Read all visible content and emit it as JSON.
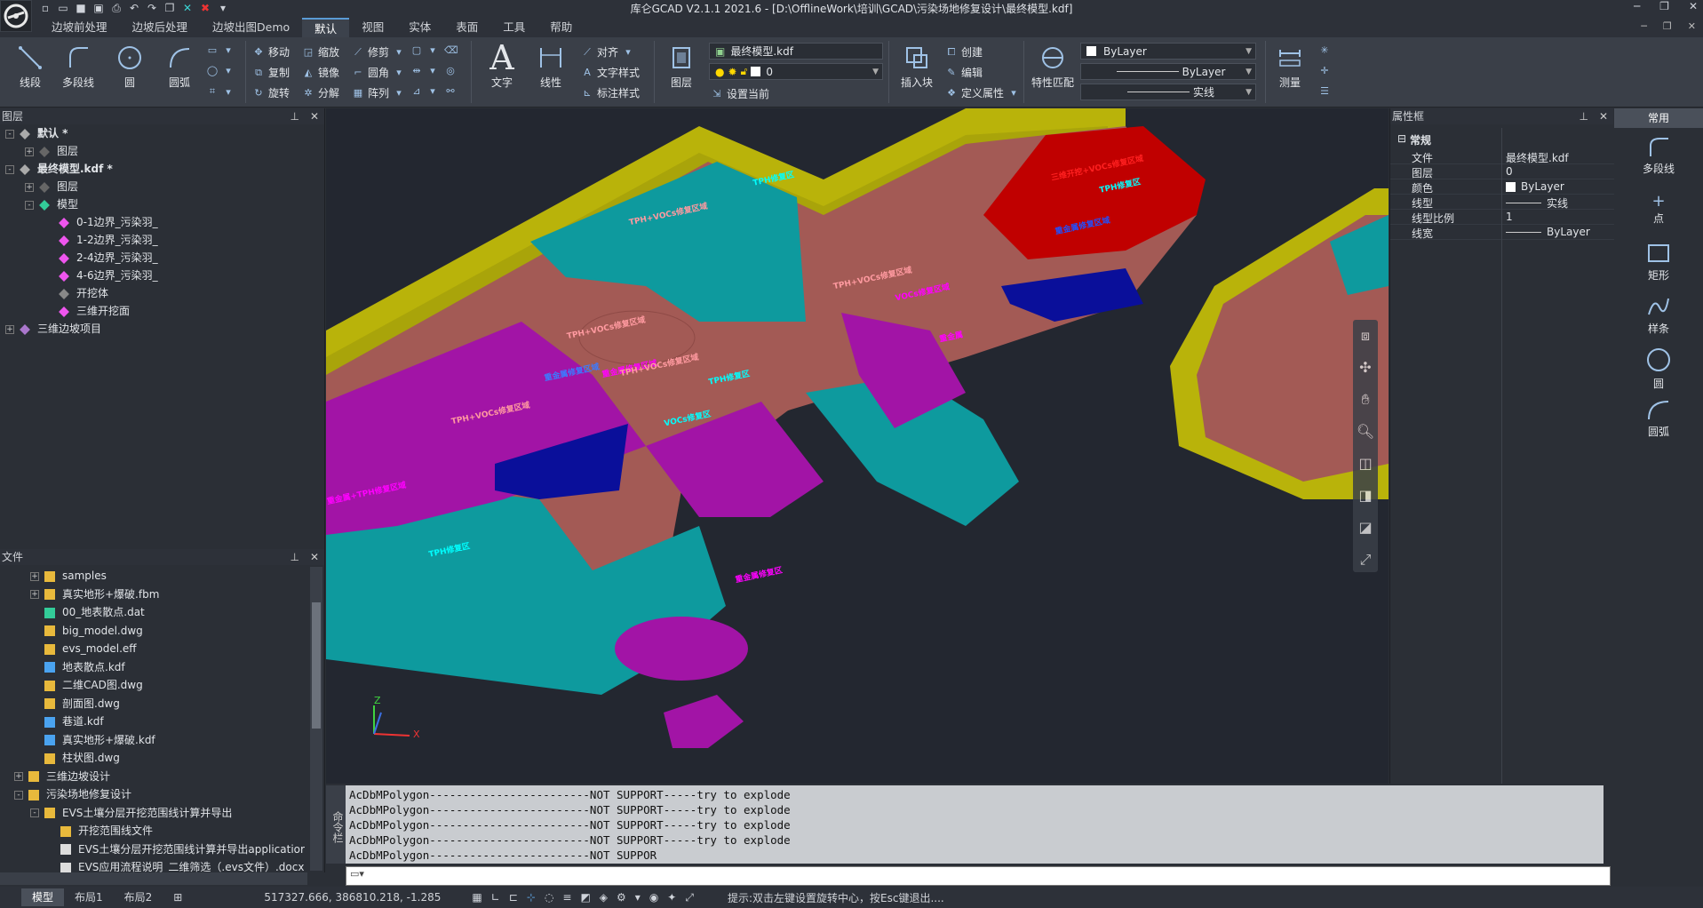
{
  "app": {
    "title": "库仑GCAD V2.1.1 2021.6 - [D:\\OfflineWork\\培训\\GCAD\\污染场地修复设计\\最终模型.kdf]"
  },
  "menu_tabs": [
    "边坡前处理",
    "边坡后处理",
    "边坡出图Demo",
    "默认",
    "视图",
    "实体",
    "表面",
    "工具",
    "帮助"
  ],
  "active_tab": "默认",
  "ribbon": {
    "draw": [
      "线段",
      "多段线",
      "圆",
      "圆弧"
    ],
    "modify_col1": [
      "移动",
      "复制",
      "旋转"
    ],
    "modify_col2": [
      "缩放",
      "镜像",
      "分解"
    ],
    "modify_col3": [
      "修剪",
      "圆角",
      "阵列"
    ],
    "text_label": "文字",
    "dim_label": "线性",
    "annot": [
      "对齐",
      "文字样式",
      "标注样式"
    ],
    "layer_label": "图层",
    "doc_combo": "最终模型.kdf",
    "layer_combo": "0",
    "set_current": "设置当前",
    "insert_block": "插入块",
    "block_ops": [
      "创建",
      "编辑",
      "定义属性"
    ],
    "match_props": "特性匹配",
    "color_combo": "ByLayer",
    "linetype_combo": "ByLayer",
    "lineweight_combo": "实线",
    "measure": "测量"
  },
  "layers_panel": {
    "title": "图层",
    "rows": [
      {
        "label": "默认 *",
        "level": 0,
        "exp": "-",
        "bold": true
      },
      {
        "label": "图层",
        "level": 1,
        "exp": "+",
        "bold": false
      },
      {
        "label": "最终模型.kdf *",
        "level": 0,
        "exp": "-",
        "bold": true
      },
      {
        "label": "图层",
        "level": 1,
        "exp": "+",
        "bold": false
      },
      {
        "label": "模型",
        "level": 1,
        "exp": "-",
        "bold": false
      },
      {
        "label": "0-1边界_污染羽_",
        "level": 2,
        "exp": "",
        "bold": false
      },
      {
        "label": "1-2边界_污染羽_",
        "level": 2,
        "exp": "",
        "bold": false
      },
      {
        "label": "2-4边界_污染羽_",
        "level": 2,
        "exp": "",
        "bold": false
      },
      {
        "label": "4-6边界_污染羽_",
        "level": 2,
        "exp": "",
        "bold": false
      },
      {
        "label": "开挖体",
        "level": 2,
        "exp": "",
        "bold": false
      },
      {
        "label": "三维开挖面",
        "level": 2,
        "exp": "",
        "bold": false
      },
      {
        "label": "三维边坡项目",
        "level": 0,
        "exp": "+",
        "bold": false
      }
    ]
  },
  "files_panel": {
    "title": "文件",
    "rows": [
      {
        "label": "samples",
        "level": 2,
        "exp": "+",
        "type": "folder"
      },
      {
        "label": "真实地形+爆破.fbm",
        "level": 2,
        "exp": "+",
        "type": "folder"
      },
      {
        "label": "00_地表散点.dat",
        "level": 2,
        "exp": "",
        "type": "dat"
      },
      {
        "label": "big_model.dwg",
        "level": 2,
        "exp": "",
        "type": "dwg"
      },
      {
        "label": "evs_model.eff",
        "level": 2,
        "exp": "",
        "type": "eff"
      },
      {
        "label": "地表散点.kdf",
        "level": 2,
        "exp": "",
        "type": "kdf"
      },
      {
        "label": "二维CAD图.dwg",
        "level": 2,
        "exp": "",
        "type": "dwg"
      },
      {
        "label": "剖面图.dwg",
        "level": 2,
        "exp": "",
        "type": "dwg"
      },
      {
        "label": "巷道.kdf",
        "level": 2,
        "exp": "",
        "type": "kdf"
      },
      {
        "label": "真实地形+爆破.kdf",
        "level": 2,
        "exp": "",
        "type": "kdf"
      },
      {
        "label": "柱状图.dwg",
        "level": 2,
        "exp": "",
        "type": "dwg"
      },
      {
        "label": "三维边坡设计",
        "level": 1,
        "exp": "+",
        "type": "folder"
      },
      {
        "label": "污染场地修复设计",
        "level": 1,
        "exp": "-",
        "type": "folder"
      },
      {
        "label": "EVS土壤分层开挖范围线计算并导出",
        "level": 2,
        "exp": "-",
        "type": "folder"
      },
      {
        "label": "开挖范围线文件",
        "level": 3,
        "exp": "",
        "type": "folder"
      },
      {
        "label": "EVS土壤分层开挖范围线计算并导出applicatior",
        "level": 3,
        "exp": "",
        "type": "doc"
      },
      {
        "label": "EVS应用流程说明_二维筛选（.evs文件）.docx",
        "level": 3,
        "exp": "",
        "type": "doc"
      }
    ]
  },
  "viewport_labels": [
    "TPH+VOCs修复区域",
    "TPH修复区",
    "TPH+VOCs修复区域",
    "重金属修复区域",
    "TPH+VOCs修复区域",
    "VOCs修复区域",
    "重金属",
    "TPH+VOCs修复区域",
    "重金属修复区域",
    "VOCs修复区",
    "TPH+VOCs修复区域",
    "TPH修复区",
    "重金属+TPH修复区域",
    "TPH修复区",
    "重金属修复区",
    "三维开挖+VOCs修复区域",
    "TPH修复区",
    "重金属修复区域"
  ],
  "axis_labels": {
    "z": "Z",
    "x": "X"
  },
  "command": {
    "label": "命令栏",
    "lines": [
      "AcDbMPolygon------------------------NOT SUPPORT-----try to explode",
      "AcDbMPolygon------------------------NOT SUPPORT-----try to explode",
      "AcDbMPolygon------------------------NOT SUPPORT-----try to explode",
      "AcDbMPolygon------------------------NOT SUPPORT-----try to explode",
      "AcDbMPolygon------------------------NOT SUPPOR"
    ]
  },
  "properties": {
    "title": "属性框",
    "section": "常规",
    "rows": [
      {
        "key": "文件",
        "value": "最终模型.kdf"
      },
      {
        "key": "图层",
        "value": "0"
      },
      {
        "key": "颜色",
        "value": "ByLayer"
      },
      {
        "key": "线型",
        "value": "实线"
      },
      {
        "key": "线型比例",
        "value": "1"
      },
      {
        "key": "线宽",
        "value": "ByLayer"
      }
    ]
  },
  "palette": {
    "title": "常用",
    "tools": [
      "多段线",
      "点",
      "矩形",
      "样条",
      "圆",
      "圆弧"
    ]
  },
  "status": {
    "tabs": [
      "模型",
      "布局1",
      "布局2"
    ],
    "coords": "517327.666, 386810.218, -1.285",
    "hint": "提示:双击左键设置旋转中心，按Esc键退出...."
  },
  "colors": {
    "accent": "#5a9bd5",
    "teal": "#0e9a9e",
    "brown": "#a35a55",
    "magenta": "#a214a6",
    "navy": "#0a0f9a",
    "red": "#c00000",
    "olive": "#b9b30a"
  }
}
